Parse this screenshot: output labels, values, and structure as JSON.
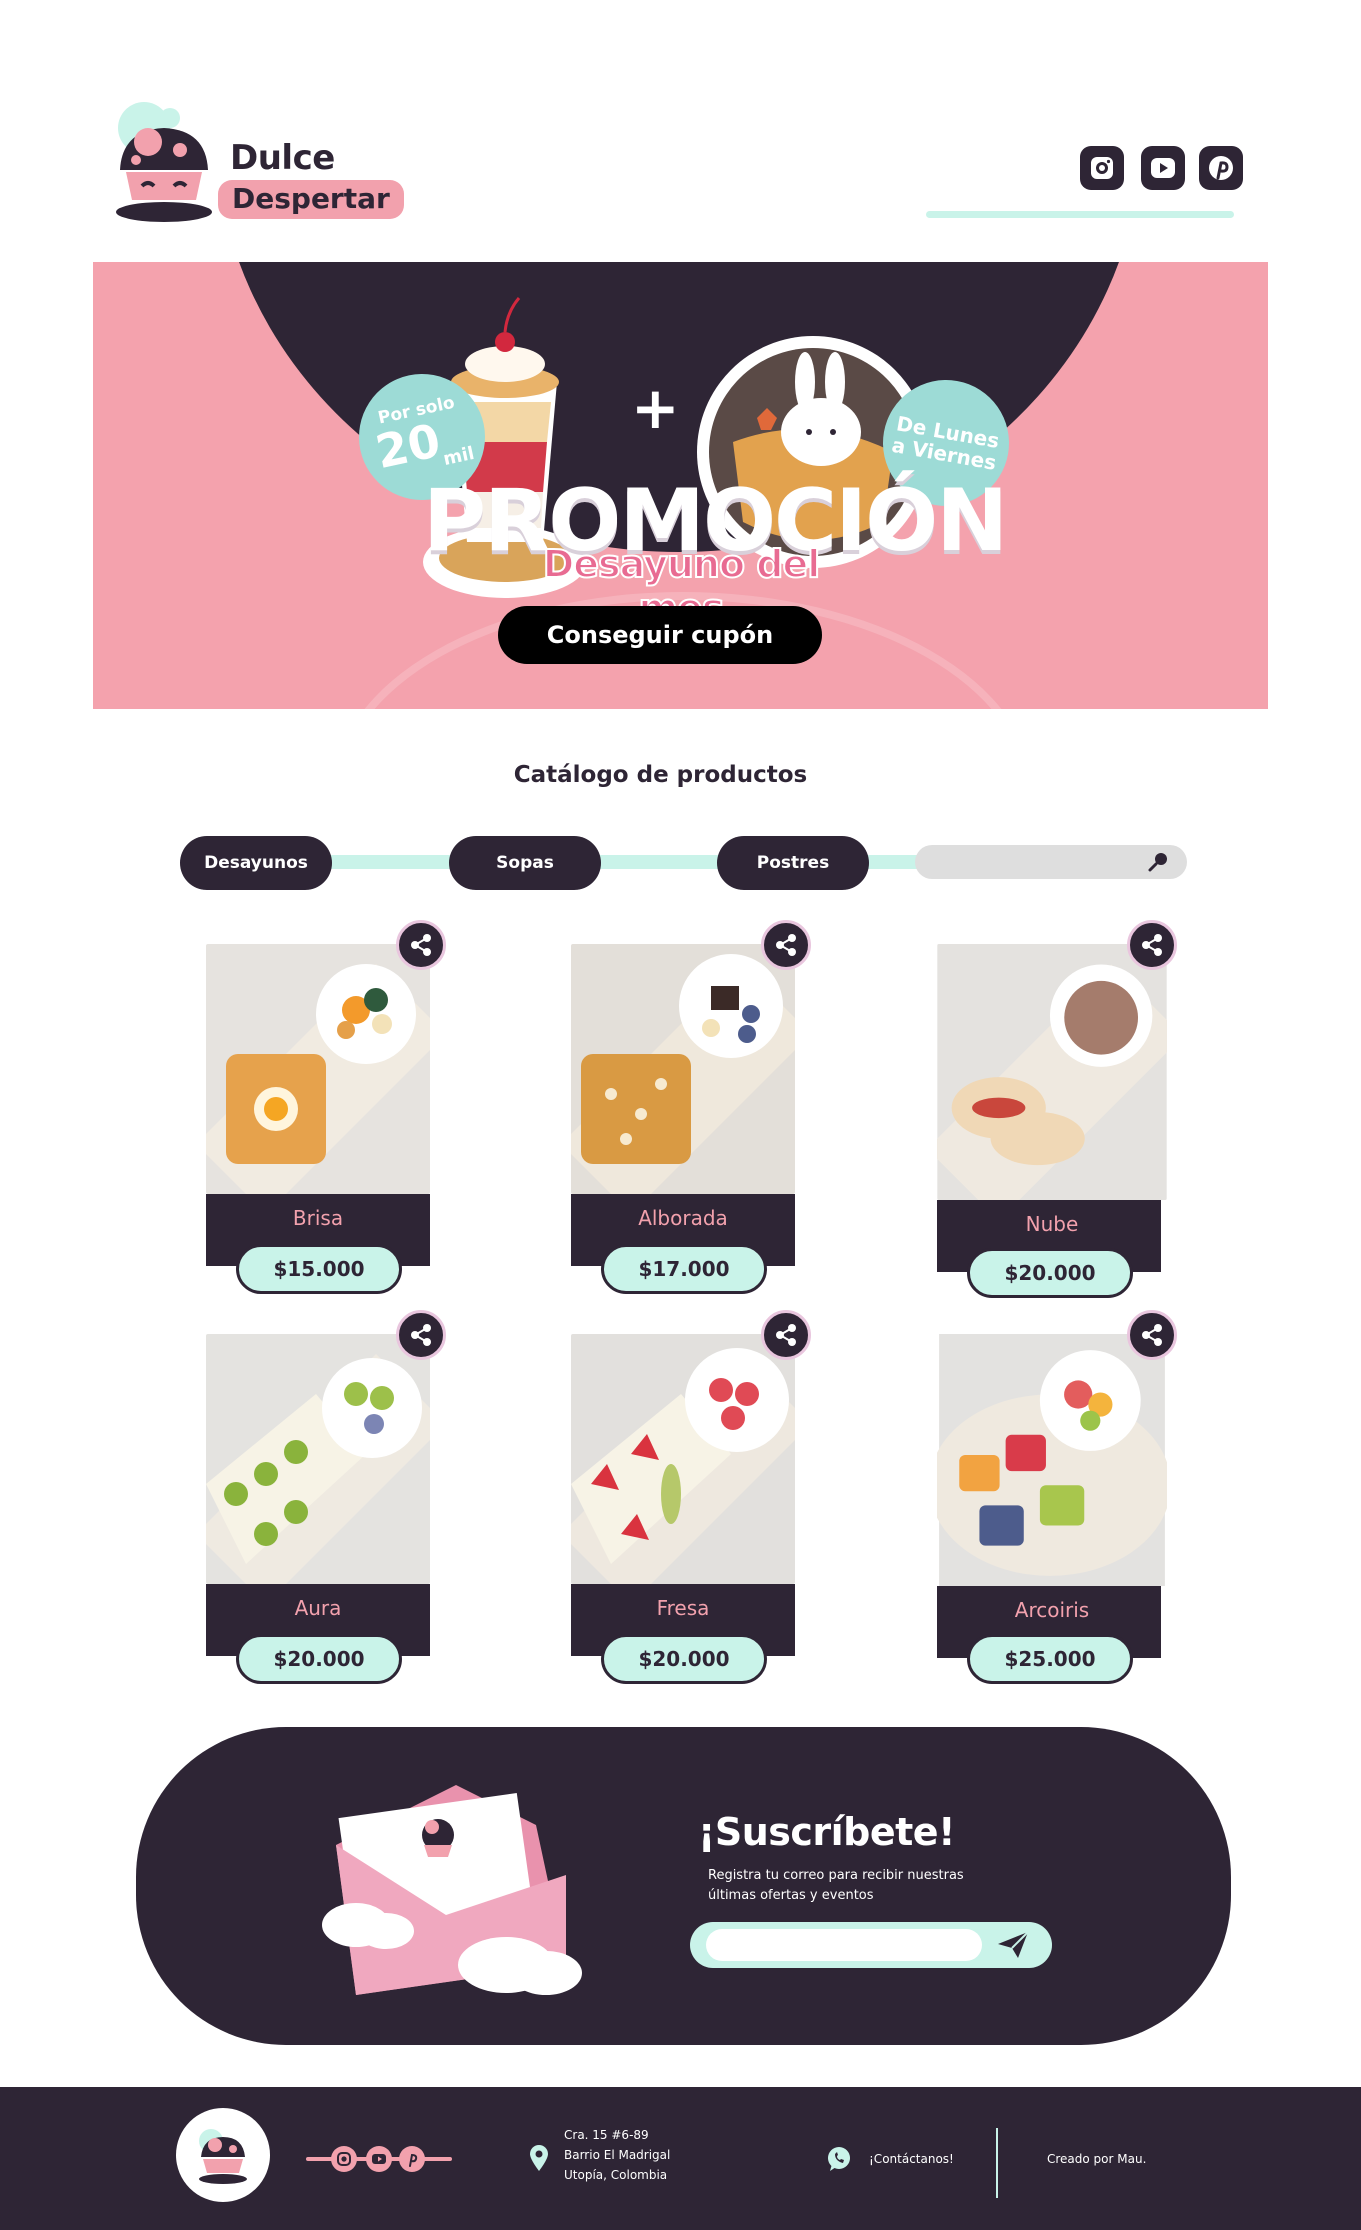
{
  "brand": {
    "line1": "Dulce",
    "line2": "Despertar",
    "colors": {
      "dark": "#2e2535",
      "pink": "#f2a1ad",
      "mint": "#c9f3e9",
      "teal": "#9ddbd6"
    }
  },
  "header": {
    "social": [
      {
        "icon": "instagram-icon"
      },
      {
        "icon": "youtube-icon"
      },
      {
        "icon": "pinterest-icon"
      }
    ]
  },
  "banner": {
    "badge_left": {
      "small": "Por solo",
      "big": "20",
      "unit": "mil"
    },
    "plus": "+",
    "badge_right": {
      "line1": "De Lunes",
      "line2": "a Viernes"
    },
    "title": "PROMOCIÓN",
    "subtitle": "Desayuno del mes",
    "cta": "Conseguir cupón"
  },
  "catalog": {
    "title": "Catálogo de productos",
    "categories": [
      "Desayunos",
      "Sopas",
      "Postres"
    ],
    "search_placeholder": ""
  },
  "products": [
    {
      "name": "Brisa",
      "price": "$15.000"
    },
    {
      "name": "Alborada",
      "price": "$17.000"
    },
    {
      "name": "Nube",
      "price": "$20.000"
    },
    {
      "name": "Aura",
      "price": "$20.000"
    },
    {
      "name": "Fresa",
      "price": "$20.000"
    },
    {
      "name": "Arcoiris",
      "price": "$25.000"
    }
  ],
  "newsletter": {
    "title": "¡Suscríbete!",
    "text": "Registra tu correo para recibir nuestras últimas ofertas y eventos",
    "placeholder": ""
  },
  "footer": {
    "address": [
      "Cra. 15 #6-89",
      "Barrio El Madrigal",
      "Utopía, Colombia"
    ],
    "contact": "¡Contáctanos!",
    "credit": "Creado por Mau."
  }
}
